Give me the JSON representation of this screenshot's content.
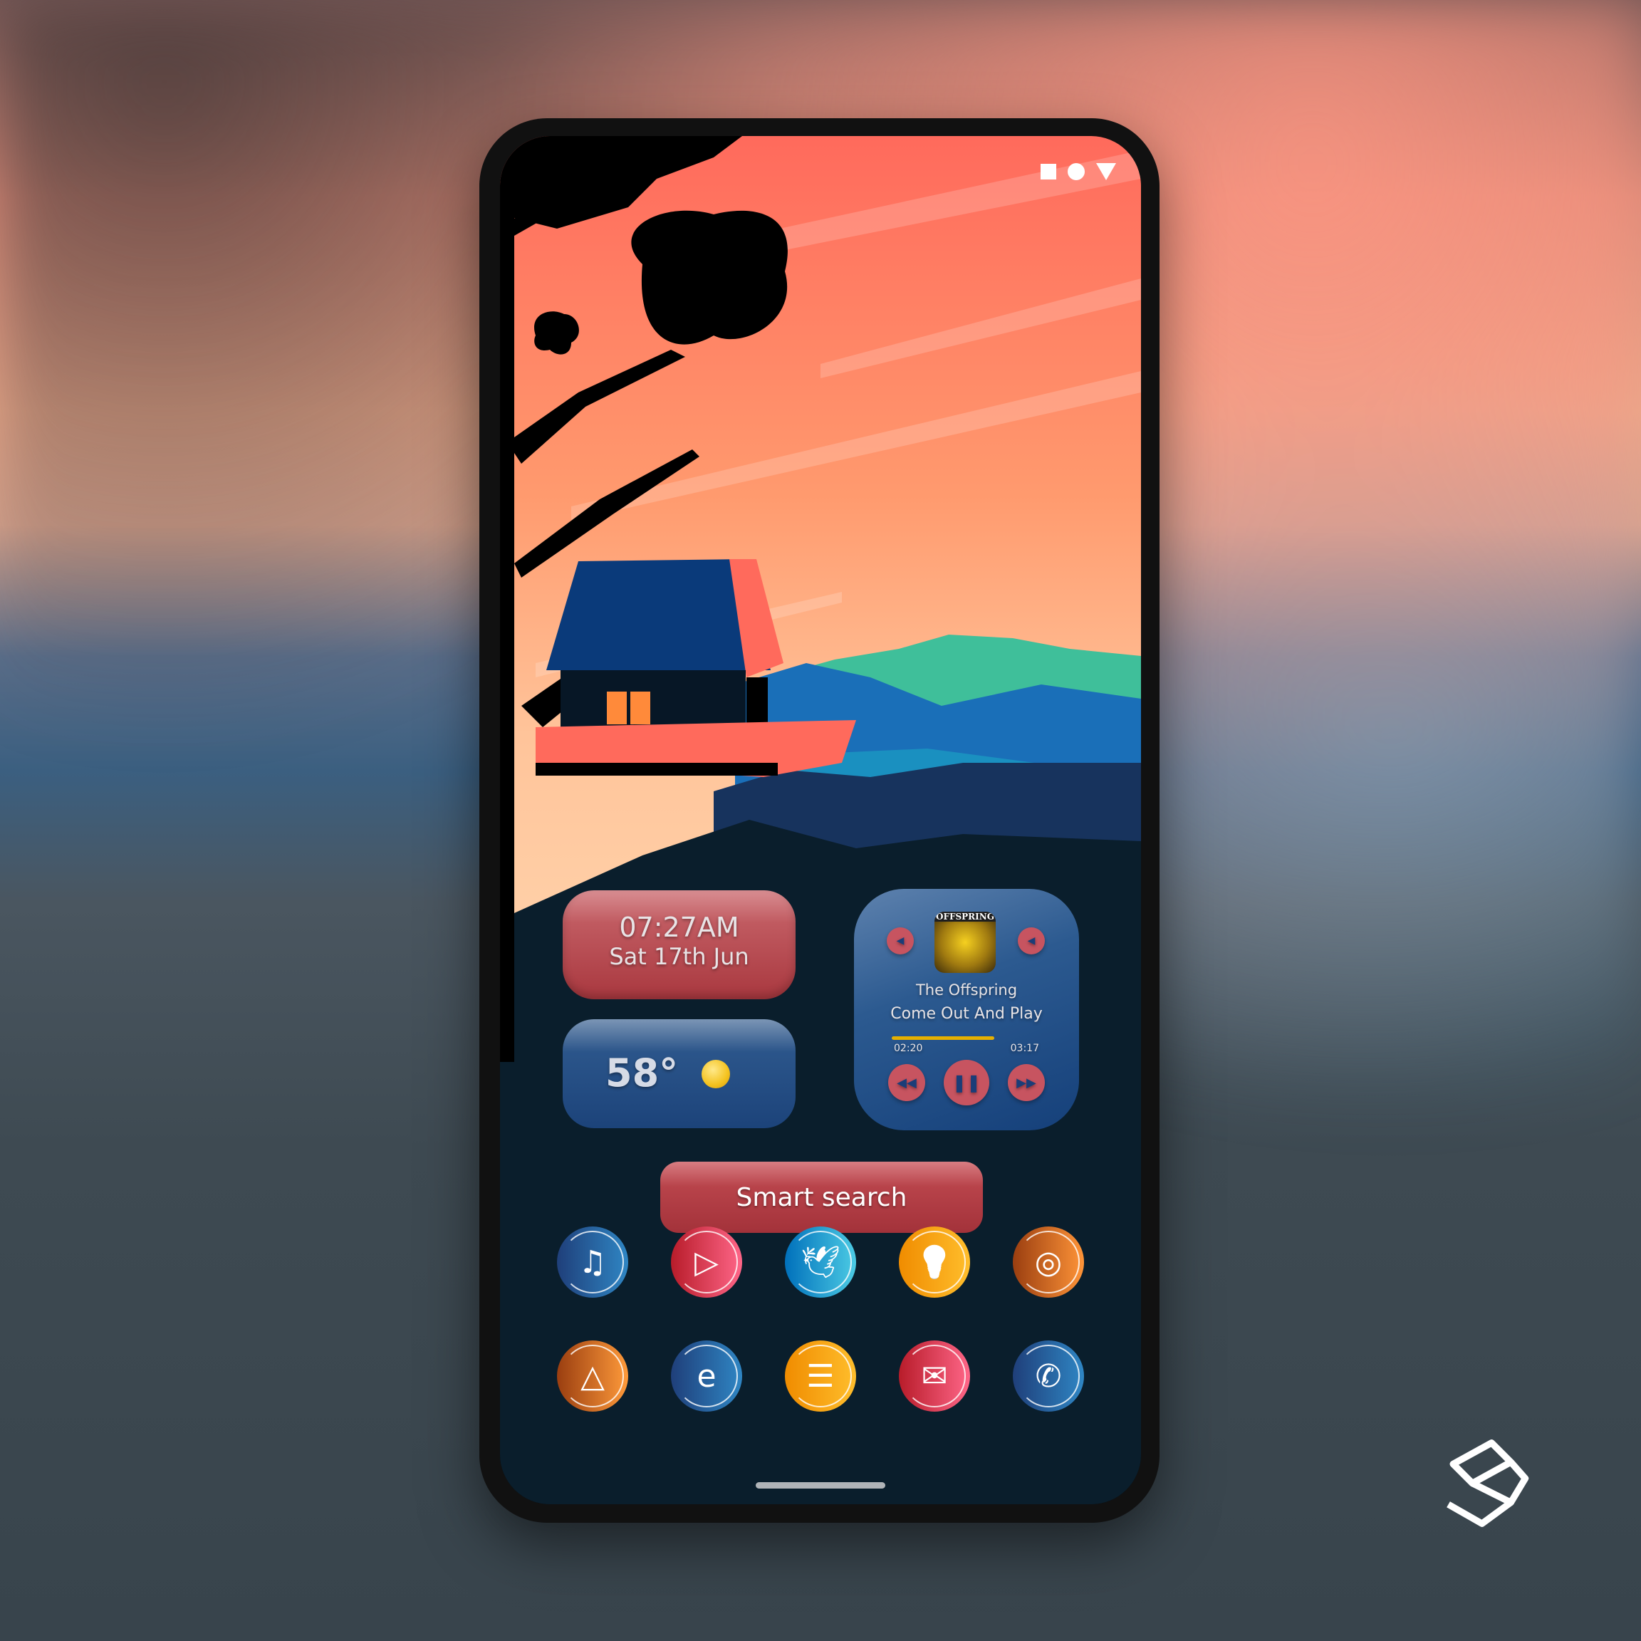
{
  "status_bar": {
    "icons": [
      "square-icon",
      "circle-icon",
      "triangle-icon"
    ]
  },
  "clock_widget": {
    "time": "07:27AM",
    "date": "Sat 17th Jun"
  },
  "weather_widget": {
    "temperature": "58°",
    "condition_icon": "sun-icon"
  },
  "music_widget": {
    "album_label": "OFFSPRING",
    "artist": "The Offspring",
    "song": "Come Out And Play",
    "elapsed": "02:20",
    "duration": "03:17",
    "progress": 0.74
  },
  "search": {
    "label": "Smart search"
  },
  "apps": [
    {
      "name": "music",
      "icon": "music-note-icon",
      "color1": "#1f3f7a",
      "color2": "#2f86c4"
    },
    {
      "name": "youtube",
      "icon": "play-icon",
      "color1": "#b81c2a",
      "color2": "#ff6688"
    },
    {
      "name": "twitter",
      "icon": "bird-icon",
      "color1": "#0070bb",
      "color2": "#4ccbe4"
    },
    {
      "name": "keep",
      "icon": "lightbulb-icon",
      "color1": "#f08c00",
      "color2": "#ffbe2c"
    },
    {
      "name": "camera",
      "icon": "camera-icon",
      "color1": "#9a3e10",
      "color2": "#ff9438"
    },
    {
      "name": "gallery",
      "icon": "image-icon",
      "color1": "#9a3e10",
      "color2": "#ff9a3a"
    },
    {
      "name": "edge",
      "icon": "edge-icon",
      "color1": "#1f3f7a",
      "color2": "#2f86c4"
    },
    {
      "name": "messages",
      "icon": "message-icon",
      "color1": "#f08c00",
      "color2": "#ffbe2c"
    },
    {
      "name": "email",
      "icon": "mail-icon",
      "color1": "#b81c2a",
      "color2": "#ff6688"
    },
    {
      "name": "phone",
      "icon": "phone-icon",
      "color1": "#1f3f7a",
      "color2": "#2f86c4"
    }
  ]
}
